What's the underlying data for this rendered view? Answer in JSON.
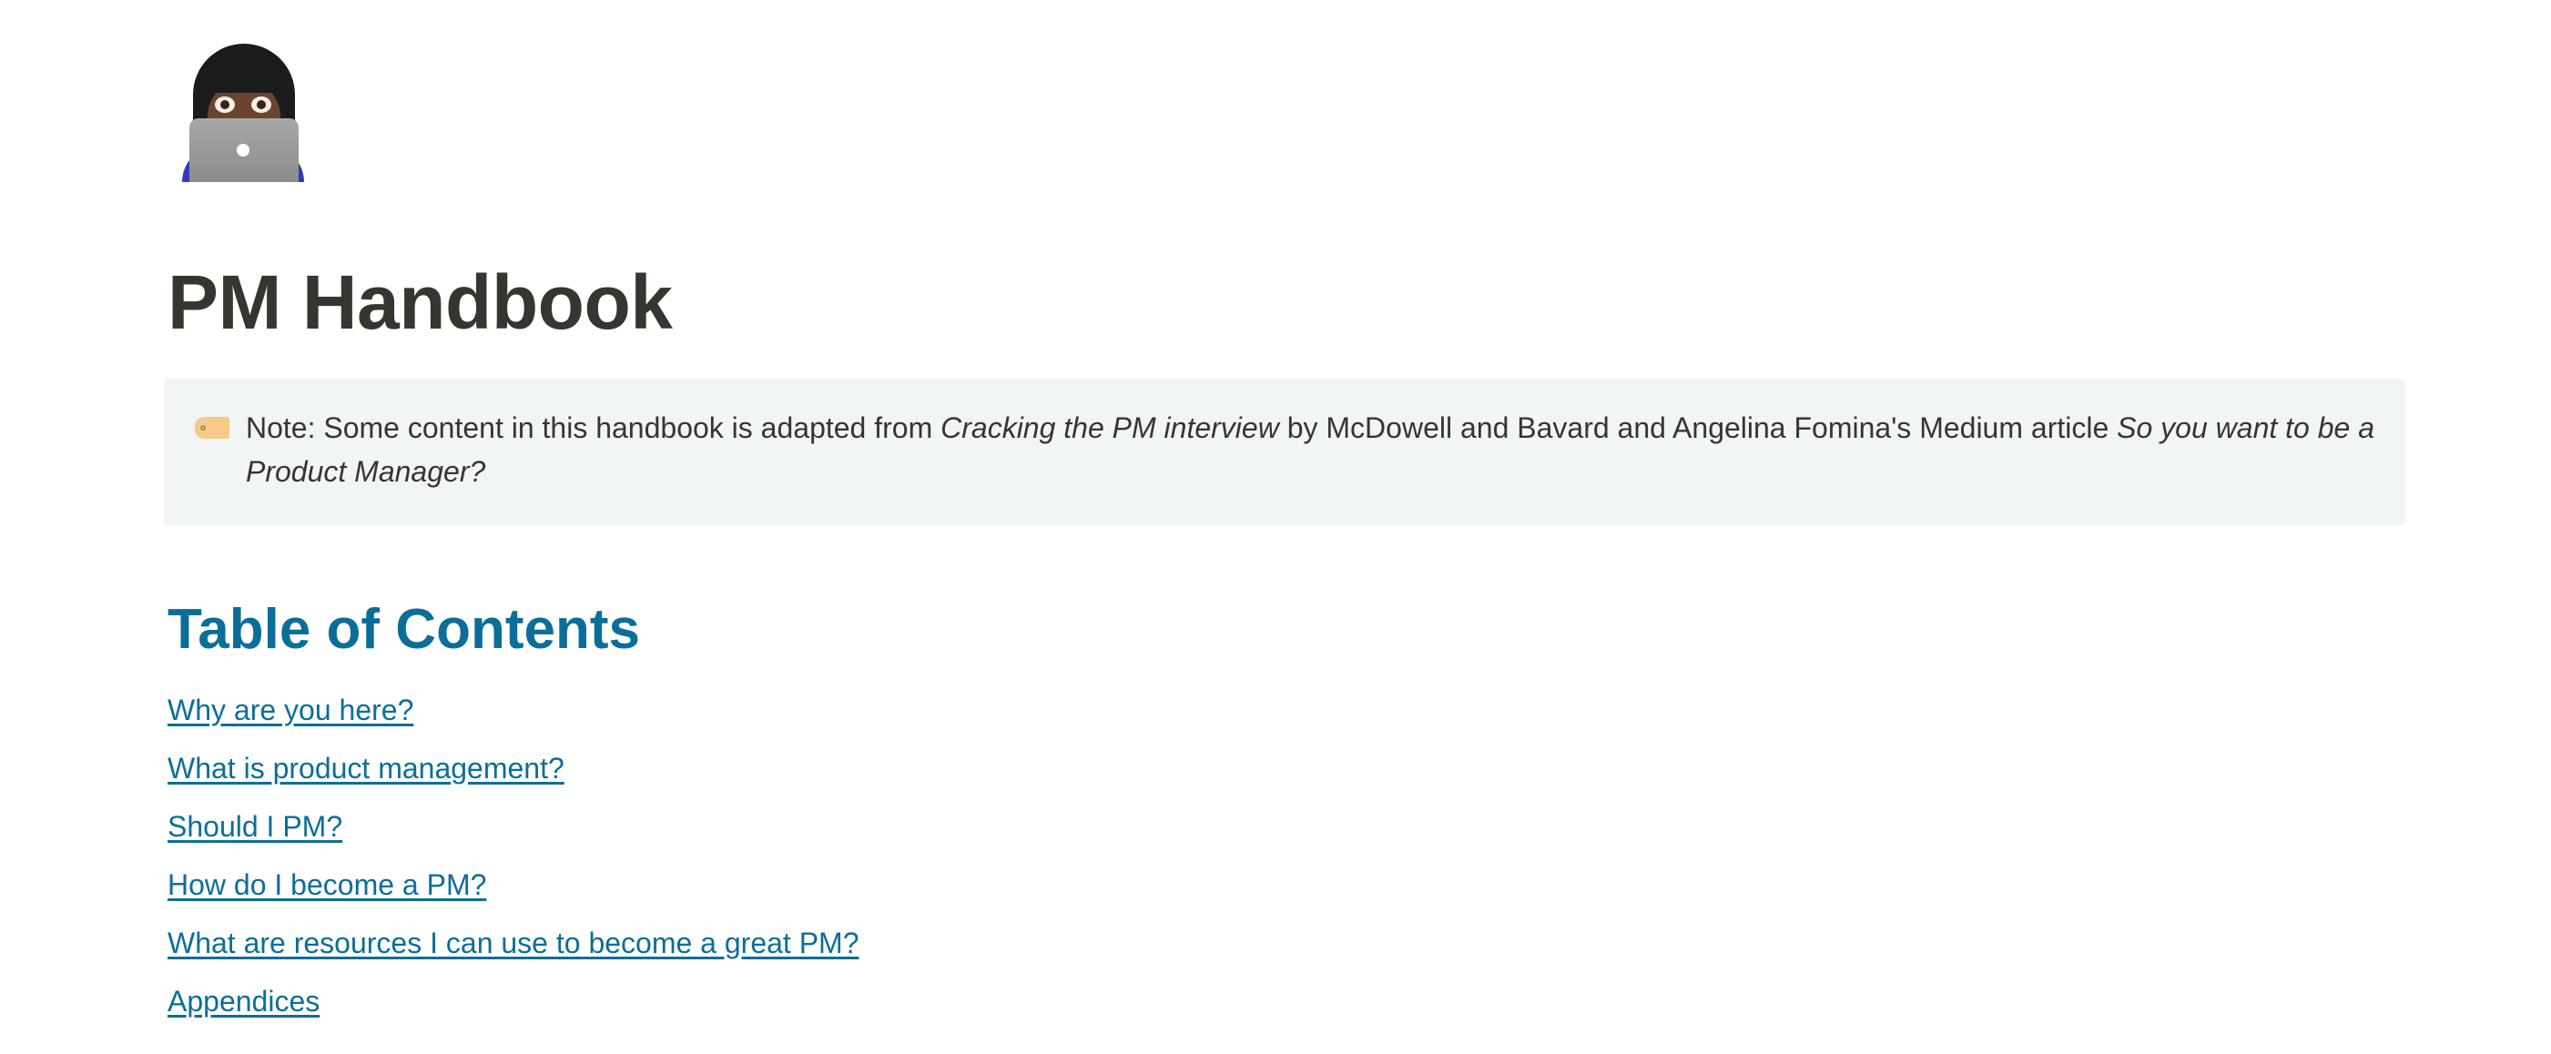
{
  "page": {
    "icon": "woman-technologist-emoji",
    "title": "PM Handbook"
  },
  "callout": {
    "icon": "label-tag-icon",
    "text_prefix": "Note: Some content in this handbook is adapted from ",
    "book_title": "Cracking the PM interview",
    "text_middle": " by McDowell and Bavard and Angelina Fomina's Medium article ",
    "article_title": "So you want to be a Product Manager?",
    "background_color": "#f1f6f4"
  },
  "toc": {
    "heading": "Table of Contents",
    "accent_color": "#0b6e99",
    "items": [
      {
        "label": "Why are you here?"
      },
      {
        "label": "What is product management?"
      },
      {
        "label": "Should I PM?"
      },
      {
        "label": "How do I become a PM?"
      },
      {
        "label": "What are resources I can use to become a great PM?"
      },
      {
        "label": "Appendices"
      }
    ]
  }
}
